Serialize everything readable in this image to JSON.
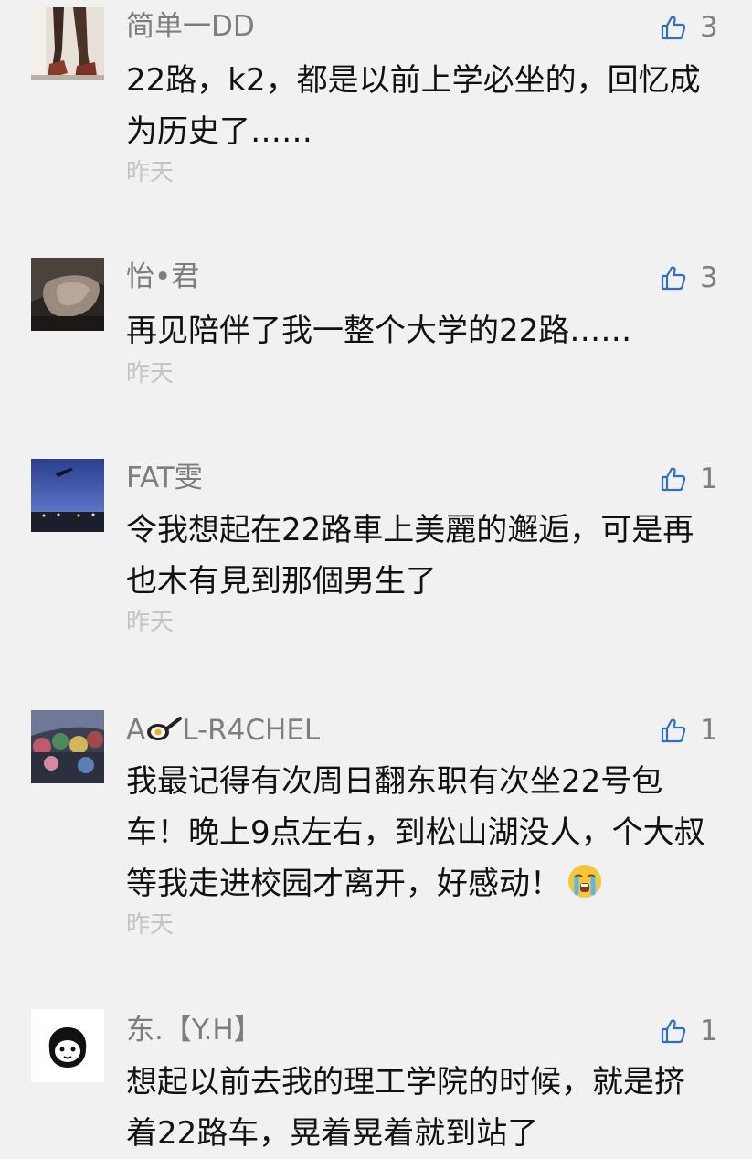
{
  "comments": [
    {
      "user": "简单一DD",
      "likes": "3",
      "text": "22路，k2，都是以前上学必坐的，回忆成为历史了……",
      "time": "昨天",
      "avatar_icon": "avatar-photo-feet-icon"
    },
    {
      "user": "怡•君",
      "likes": "3",
      "text": "再见陪伴了我一整个大学的22路……",
      "time": "昨天",
      "avatar_icon": "avatar-photo-arm-icon"
    },
    {
      "user": "FAT雯",
      "likes": "1",
      "text": "令我想起在22路車上美麗的邂逅，可是再也木有見到那個男生了",
      "time": "昨天",
      "avatar_icon": "avatar-photo-sky-icon"
    },
    {
      "user_prefix": "A",
      "user_suffix": "L-R4CHEL",
      "user_glyph": "frying-pan-egg-icon",
      "likes": "1",
      "text": "我最记得有次周日翻东职有次坐22号包车！晚上9点左右，到松山湖没人，个大叔等我走进校园才离开，好感动！",
      "text_emoji": "crying-face-icon",
      "time": "昨天",
      "avatar_icon": "avatar-photo-crowd-icon"
    },
    {
      "user": "东.【Y.H】",
      "likes": "1",
      "text": "想起以前去我的理工学院的时候，就是挤着22路车，晃着晃着就到站了",
      "avatar_icon": "avatar-cartoon-face-icon"
    }
  ],
  "colors": {
    "background": "#f1f1f1",
    "name": "#7d7d7d",
    "text": "#111111",
    "time": "#c4c4c4",
    "like_icon": "#2f6fc8"
  },
  "icons": {
    "like": "thumbs-up-icon"
  }
}
